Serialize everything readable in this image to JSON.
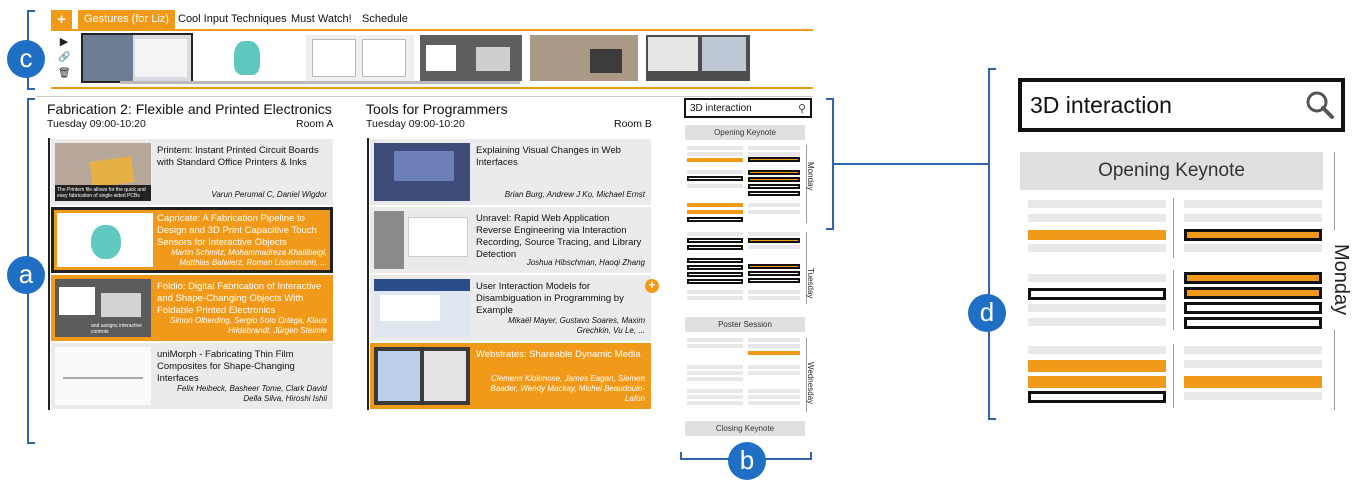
{
  "callouts": {
    "a": "a",
    "b": "b",
    "c": "c",
    "d": "d"
  },
  "toolbar": {
    "add_label": "+",
    "tabs": [
      "Gestures (for Liz)",
      "Cool Input Techniques",
      "Must Watch!",
      "Schedule"
    ],
    "active_tab": 0,
    "controls": {
      "play": "▶",
      "link": "🔗",
      "delete": "🗑"
    }
  },
  "sessions": [
    {
      "title": "Fabrication 2: Flexible and Printed Electronics",
      "time": "Tuesday 09:00-10:20",
      "room": "Room A",
      "papers": [
        {
          "title": "Printem: Instant Printed Circuit Boards with Standard Office Printers & Inks",
          "authors": "Varun Perumal C, Daniel Wigdor",
          "thumb_caption": "The Printem file allows for the quick and easy fabrication of single-sided PCBs",
          "state": "normal"
        },
        {
          "title": "Capricate: A Fabrication Pipeline to Design and 3D Print Capacitive Touch Sensors for Interactive Objects",
          "authors": "Martin Schmitz, Mohammadreza Khalilbeigi, Matthias Balwierz, Roman Lissermann, ...",
          "state": "selected"
        },
        {
          "title": "Foldio: Digital Fabrication of Interactive and Shape-Changing Objects With Foldable Printed Electronics",
          "authors": "Simon Olberding, Sergio Soto Ortega, Klaus Hildebrandt, Jürgen Steimle",
          "thumb_caption": "and assigns interactive controls",
          "state": "highlight"
        },
        {
          "title": "uniMorph - Fabricating Thin Film Composites for Shape-Changing Interfaces",
          "authors": "Felix Heibeck, Basheer Tome, Clark David Della Silva, Hiroshi Ishii",
          "state": "normal"
        }
      ]
    },
    {
      "title": "Tools for Programmers",
      "time": "Tuesday 09:00-10:20",
      "room": "Room B",
      "papers": [
        {
          "title": "Explaining Visual Changes in Web Interfaces",
          "authors": "Brian Burg, Andrew J Ko, Michael Ernst",
          "state": "normal"
        },
        {
          "title": "Unravel: Rapid Web Application Reverse Engineering via Interaction Recording, Source Tracing, and Library Detection",
          "authors": "Joshua Hibschman, Haoqi Zhang",
          "state": "normal"
        },
        {
          "title": "User Interaction Models for Disambiguation in Programming by Example",
          "authors": "Mikaël Mayer, Gustavo Soares, Maxim Grechkin, Vu Le, ...",
          "state": "normal"
        },
        {
          "title": "Webstrates: Shareable Dynamic Media",
          "authors": "Clemens Klokmose, James Eagan, Siemen Baader, Wendy Mackay, Michel Beaudouin-Lafon",
          "state": "highlight"
        }
      ]
    }
  ],
  "add_to_playlist_icon": "+",
  "overview": {
    "search_value": "3D interaction",
    "blocks": {
      "opening": "Opening Keynote",
      "poster": "Poster Session",
      "closing": "Closing Keynote"
    },
    "days": [
      "Monday",
      "Tuesday",
      "Wednesday"
    ]
  },
  "zoom": {
    "search_value": "3D interaction",
    "opening": "Opening Keynote",
    "day": "Monday"
  },
  "colors": {
    "accent": "#f19a1a",
    "callout": "#1f6fc5",
    "bracket": "#2f62b0"
  }
}
